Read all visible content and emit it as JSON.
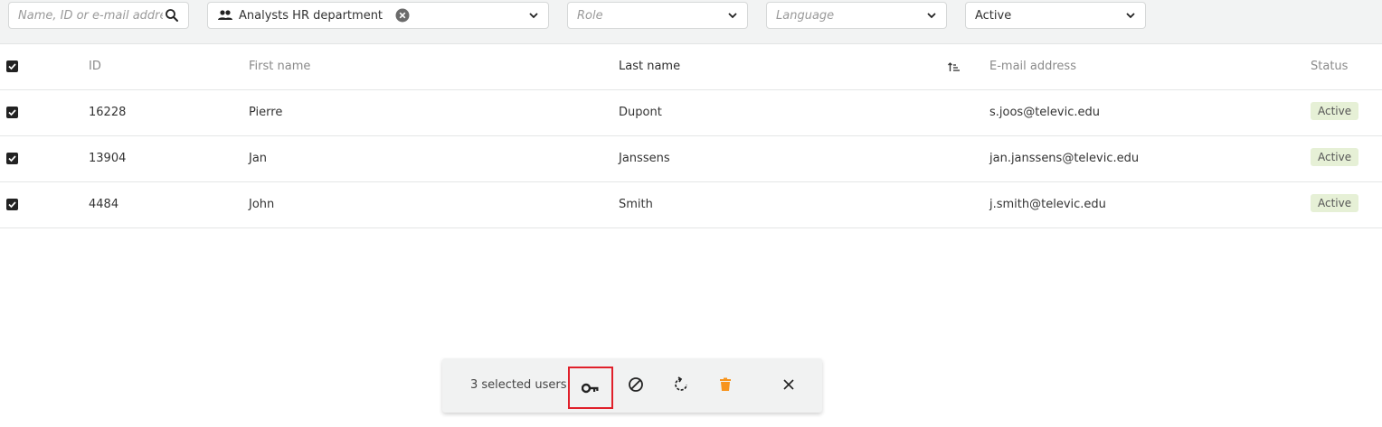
{
  "filters": {
    "search": {
      "placeholder": "Name, ID or e-mail address",
      "icon": "search-icon"
    },
    "group": {
      "chip_label": "Analysts HR department",
      "icon": "people-icon"
    },
    "role": {
      "placeholder": "Role"
    },
    "language": {
      "placeholder": "Language"
    },
    "status": {
      "value": "Active"
    }
  },
  "table": {
    "columns": {
      "id": "ID",
      "first_name": "First name",
      "last_name": "Last name",
      "email": "E-mail address",
      "status": "Status"
    },
    "sorted_by": "last_name",
    "rows": [
      {
        "checked": true,
        "id": "16228",
        "first_name": "Pierre",
        "last_name": "Dupont",
        "email": "s.joos@televic.edu",
        "status": "Active"
      },
      {
        "checked": true,
        "id": "13904",
        "first_name": "Jan",
        "last_name": "Janssens",
        "email": "jan.janssens@televic.edu",
        "status": "Active"
      },
      {
        "checked": true,
        "id": "4484",
        "first_name": "John",
        "last_name": "Smith",
        "email": "j.smith@televic.edu",
        "status": "Active"
      }
    ]
  },
  "selection_bar": {
    "count_label": "3 selected users",
    "actions": [
      "key-icon",
      "block-icon",
      "refresh-icon",
      "delete-icon",
      "close-icon"
    ],
    "highlighted_action": "key-icon"
  },
  "colors": {
    "badge_bg": "#e6f0d6",
    "delete_icon": "#f7941d",
    "highlight_border": "#e0202a",
    "filterbar_bg": "#f2f3f3"
  }
}
